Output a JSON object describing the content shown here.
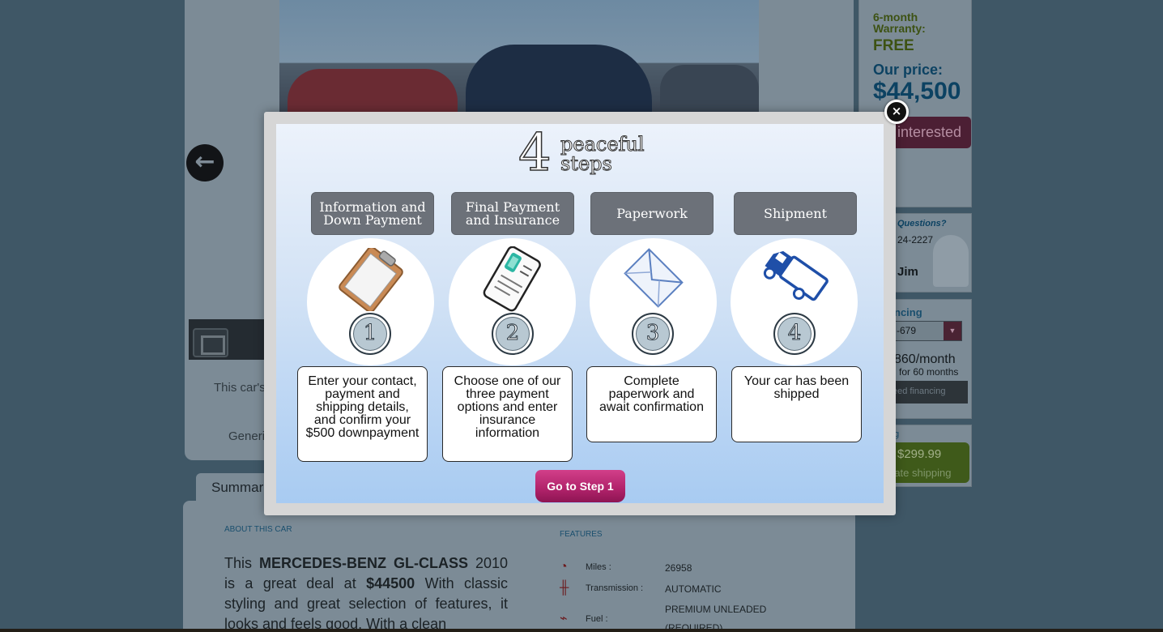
{
  "background": {
    "gallery_caption_partial": "This car's",
    "generic_partial": "Generi",
    "summary_tab": "Summar",
    "about_label": "ABOUT THIS CAR",
    "about_text": {
      "pre": "This ",
      "model": "MERCEDES-BENZ GL-CLASS",
      "mid": " 2010 is a great deal at ",
      "price": "$44500",
      "post": " With classic styling and great selection of features, it looks and feels good. With a clean"
    },
    "features_label": "FEATURES",
    "features": [
      {
        "icon": "speedometer-icon",
        "label": "Miles :",
        "value": "26958"
      },
      {
        "icon": "transmission-icon",
        "label": "Transmission :",
        "value": "AUTOMATIC"
      },
      {
        "icon": "",
        "label": "",
        "value": "PREMIUM UNLEADED"
      },
      {
        "icon": "fuel-icon",
        "label": "Fuel :",
        "value": "(REQUIRED)"
      }
    ],
    "sidebar": {
      "warranty_label": "6-month Warranty:",
      "warranty_value": "FREE",
      "our_price_label": "Our price:",
      "our_price": "$44,500",
      "interested_button": "interested",
      "questions_label": "Questions?",
      "phone_partial": "24-2227",
      "agent_name": "Jim",
      "financing_label": "ncing",
      "financing_select_value": "-679",
      "monthly": "860/month",
      "months": "for 60 months",
      "need_financing_button": "eed financing",
      "shipping_label": "g",
      "shipping_price": "$299.99",
      "shipping_text": "rate shipping"
    }
  },
  "modal": {
    "title_number": "4",
    "title_line1": "peaceful",
    "title_line2": "steps",
    "close_label": "×",
    "steps": [
      {
        "title": "Information and Down Payment",
        "number": "1",
        "icon": "clipboard-icon",
        "description": "Enter your contact, payment and shipping details, and confirm your $500 downpayment"
      },
      {
        "title": "Final Payment and Insurance",
        "number": "2",
        "icon": "credit-card-icon",
        "description": "Choose one of our three payment options and enter insurance information"
      },
      {
        "title": "Paperwork",
        "number": "3",
        "icon": "envelope-icon",
        "description": "Complete paperwork and await confirmation"
      },
      {
        "title": "Shipment",
        "number": "4",
        "icon": "truck-icon",
        "description": "Your car has been shipped"
      }
    ],
    "go_button": "Go to Step 1"
  },
  "colors": {
    "accent_pink": "#b0226a",
    "step_title_gray": "#6c7179",
    "icon_blue": "#1f4fa8",
    "backdrop": "#3f5766"
  }
}
